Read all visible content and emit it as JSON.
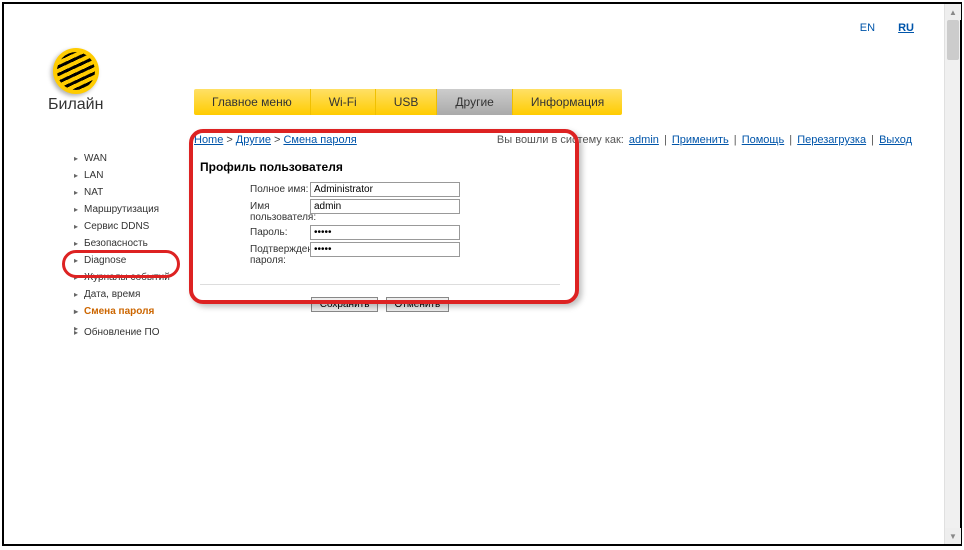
{
  "lang": {
    "en": "EN",
    "ru": "RU"
  },
  "brand": "Билайн",
  "nav": {
    "main": "Главное меню",
    "wifi": "Wi-Fi",
    "usb": "USB",
    "other": "Другие",
    "info": "Информация"
  },
  "sidebar": {
    "wan": "WAN",
    "lan": "LAN",
    "nat": "NAT",
    "routing": "Маршрутизация",
    "ddns": "Сервис DDNS",
    "security": "Безопасность",
    "diagnose": "Diagnose",
    "logs": "Журналы событий",
    "datetime": "Дата, время",
    "changepw": "Смена пароля",
    "lang": "",
    "fw": "Обновление ПО"
  },
  "breadcrumb": {
    "home": "Home",
    "other": "Другие",
    "page": "Смена пароля"
  },
  "loginbar": {
    "prefix": "Вы вошли в систему как: ",
    "user": "admin",
    "apply": "Применить",
    "help": "Помощь",
    "reboot": "Перезагрузка",
    "logout": "Выход"
  },
  "panel": {
    "title": "Профиль пользователя",
    "fullname_label": "Полное имя:",
    "fullname_value": "Administrator",
    "username_label": "Имя пользователя:",
    "username_value": "admin",
    "password_label": "Пароль:",
    "password_value": "•••••",
    "confirm_label": "Подтверждение пароля:",
    "confirm_value": "•••••",
    "save": "Сохранить",
    "cancel": "Отменить"
  }
}
